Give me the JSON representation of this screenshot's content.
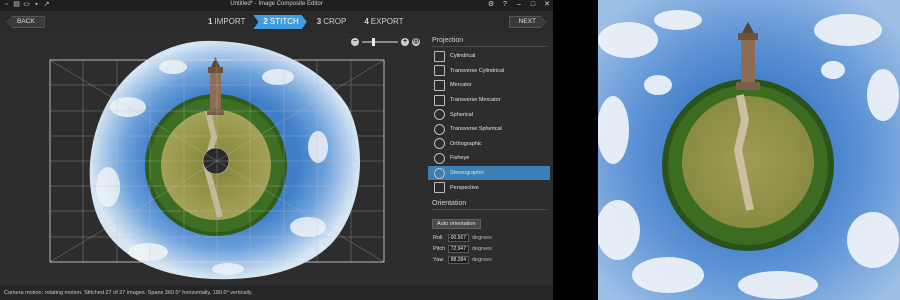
{
  "window": {
    "title": "Untitled* - Image Composite Editor",
    "quick_access_icons": [
      "new-icon",
      "open-icon",
      "folder-icon",
      "save-icon",
      "publish-icon"
    ],
    "controls": {
      "settings": "⚙",
      "help": "?",
      "minimize": "–",
      "maximize": "□",
      "close": "✕"
    }
  },
  "nav": {
    "back": "BACK",
    "next": "NEXT",
    "steps": [
      {
        "num": "1",
        "label": "IMPORT",
        "active": false
      },
      {
        "num": "2",
        "label": "STITCH",
        "active": true
      },
      {
        "num": "3",
        "label": "CROP",
        "active": false
      },
      {
        "num": "4",
        "label": "EXPORT",
        "active": false
      }
    ]
  },
  "zoom": {
    "out": "−",
    "in": "+",
    "fit": "◎",
    "level": 0.3
  },
  "panel": {
    "projection_heading": "Projection",
    "projections": [
      {
        "label": "Cylindrical",
        "icon": "cylindrical-icon",
        "selected": false
      },
      {
        "label": "Transverse Cylindrical",
        "icon": "transverse-cylindrical-icon",
        "selected": false
      },
      {
        "label": "Mercator",
        "icon": "mercator-icon",
        "selected": false
      },
      {
        "label": "Transverse Mercator",
        "icon": "transverse-mercator-icon",
        "selected": false
      },
      {
        "label": "Spherical",
        "icon": "spherical-icon",
        "selected": false
      },
      {
        "label": "Transverse Spherical",
        "icon": "transverse-spherical-icon",
        "selected": false
      },
      {
        "label": "Orthographic",
        "icon": "orthographic-icon",
        "selected": false
      },
      {
        "label": "Fisheye",
        "icon": "fisheye-icon",
        "selected": false
      },
      {
        "label": "Stereographic",
        "icon": "stereographic-icon",
        "selected": true
      },
      {
        "label": "Perspective",
        "icon": "perspective-icon",
        "selected": false
      }
    ],
    "orientation_heading": "Orientation",
    "auto_orientation": "Auto orientation",
    "orientation": [
      {
        "label": "Roll",
        "value": "-90.567",
        "unit": "degrees"
      },
      {
        "label": "Pitch",
        "value": "72.947",
        "unit": "degrees"
      },
      {
        "label": "Yaw",
        "value": "88.284",
        "unit": "degrees"
      }
    ]
  },
  "status": "Camera motion: rotating motion. Stitched 27 of 27 images. Spans 360.0° horizontally, 180.0° vertically.",
  "colors": {
    "accent": "#3d9de0",
    "selected": "#3b7fb4",
    "sky": "#5b94d6",
    "grass": "#9a9a4a",
    "forest": "#2f5a1c"
  }
}
